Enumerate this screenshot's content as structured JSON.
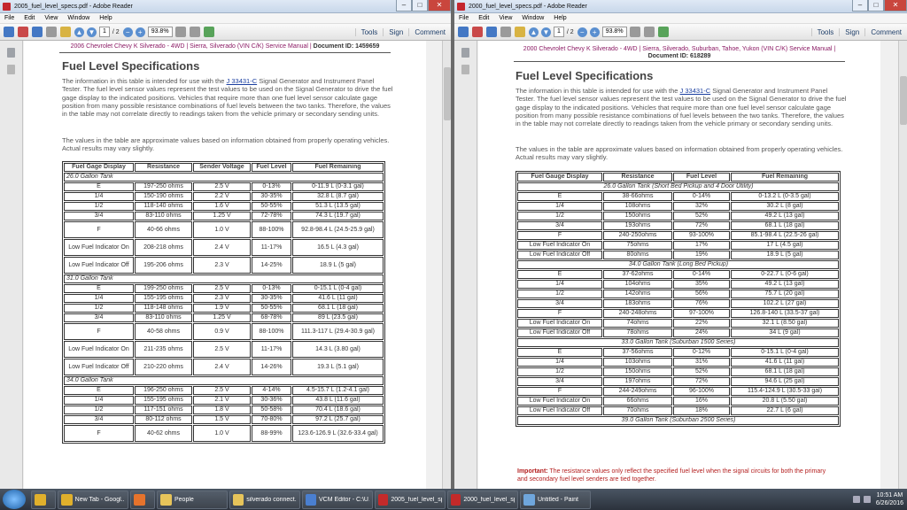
{
  "taskbar": {
    "items": [
      {
        "label": "",
        "icon": "chrome-icon"
      },
      {
        "label": "New Tab - Googl...",
        "icon": "chrome-icon"
      },
      {
        "label": "",
        "icon": "firefox-icon"
      },
      {
        "label": "People",
        "icon": "folder-icon"
      },
      {
        "label": "silverado connect...",
        "icon": "folder-icon"
      },
      {
        "label": "VCM Editor - C:\\U...",
        "icon": "vcm-icon"
      },
      {
        "label": "2005_fuel_level_sp...",
        "icon": "pdf-icon"
      },
      {
        "label": "2000_fuel_level_sp...",
        "icon": "pdf-icon"
      },
      {
        "label": "Untitled - Paint",
        "icon": "paint-icon"
      }
    ],
    "clock": {
      "time": "10:51 AM",
      "date": "6/26/2016"
    }
  },
  "w1": {
    "title": "2005_fuel_level_specs.pdf - Adobe Reader",
    "menu": [
      "File",
      "Edit",
      "View",
      "Window",
      "Help"
    ],
    "page": "1",
    "pages": "/ 2",
    "zoom": "93.8%",
    "tools": "Tools",
    "sign": "Sign",
    "comment": "Comment",
    "hdr_vehicle": "2006 Chevrolet Chevy K Silverado - 4WD",
    "hdr_sep": " | ",
    "hdr_manual": "Sierra, Silverado (VIN C/K) Service Manual",
    "hdr_sep2": " | ",
    "doc_id": "Document ID: 1459659",
    "heading": "Fuel Level Specifications",
    "p1a": "The information in this table is intended for use with the ",
    "p1link": "J 33431-C",
    "p1b": " Signal Generator and Instrument Panel Tester. The fuel level sensor values represent the test values to be used on the Signal Generator to drive the fuel gage display to the indicated positions. Vehicles that require more than one fuel level sensor calculate gage position from many possible resistance combinations of fuel levels between the two tanks. Therefore, the values in the table may not correlate directly to readings taken from the vehicle primary or secondary sending units.",
    "p2": "The values in the table are approximate values based on information obtained from properly operating vehicles. Actual results may vary slightly.",
    "cols": [
      "Fuel Gage Display",
      "Resistance",
      "Sender Voltage",
      "Fuel Level",
      "Fuel Remaining"
    ],
    "rows": [
      {
        "sec": "26.0 Gallon Tank"
      },
      {
        "c": [
          "E",
          "197-250 ohms",
          "2.5 V",
          "0-13%",
          "0-11.9 L (0-3.1 gal)"
        ]
      },
      {
        "c": [
          "1/4",
          "150-190 ohms",
          "2.2 V",
          "30-35%",
          "32.8 L (8.7 gal)"
        ]
      },
      {
        "c": [
          "1/2",
          "118-140 ohms",
          "1.6 V",
          "50-55%",
          "51.3 L (13.5 gal)"
        ]
      },
      {
        "c": [
          "3/4",
          "83-110 ohms",
          "1.25 V",
          "72-78%",
          "74.3 L (19.7 gal)"
        ]
      },
      {
        "c": [
          "F",
          "40-66 ohms",
          "1.0 V",
          "88-100%",
          "92.8-98.4 L (24.5-25.9 gal)"
        ],
        "tall": 1
      },
      {
        "c": [
          "Low Fuel Indicator On",
          "208-218 ohms",
          "2.4 V",
          "11-17%",
          "16.5 L (4.3 gal)"
        ],
        "tall": 1
      },
      {
        "c": [
          "Low Fuel Indicator Off",
          "195-206 ohms",
          "2.3 V",
          "14-25%",
          "18.9 L (5 gal)"
        ],
        "tall": 1
      },
      {
        "sec": "31.0 Gallon Tank"
      },
      {
        "c": [
          "E",
          "199-250 ohms",
          "2.5 V",
          "0-13%",
          "0-15.1 L (0-4 gal)"
        ]
      },
      {
        "c": [
          "1/4",
          "155-195 ohms",
          "2.3 V",
          "30-35%",
          "41.6 L (11 gal)"
        ]
      },
      {
        "c": [
          "1/2",
          "118-148 ohms",
          "1.9 V",
          "50-55%",
          "68.1 L (18 gal)"
        ]
      },
      {
        "c": [
          "3/4",
          "83-110 ohms",
          "1.25 V",
          "68-78%",
          "89 L (23.5 gal)"
        ]
      },
      {
        "c": [
          "F",
          "40-58 ohms",
          "0.9 V",
          "88-100%",
          "111.3-117 L (29.4-30.9 gal)"
        ],
        "tall": 1
      },
      {
        "c": [
          "Low Fuel Indicator On",
          "211-235 ohms",
          "2.5 V",
          "11-17%",
          "14.3 L (3.80 gal)"
        ],
        "tall": 1
      },
      {
        "c": [
          "Low Fuel Indicator Off",
          "210-220 ohms",
          "2.4 V",
          "14-26%",
          "19.3 L (5.1 gal)"
        ],
        "tall": 1
      },
      {
        "sec": "34.0 Gallon Tank"
      },
      {
        "c": [
          "E",
          "196-250 ohms",
          "2.5 V",
          "4-14%",
          "4.5-15.7 L (1.2-4.1 gal)"
        ]
      },
      {
        "c": [
          "1/4",
          "155-195 ohms",
          "2.1 V",
          "30-36%",
          "43.8 L (11.6 gal)"
        ]
      },
      {
        "c": [
          "1/2",
          "117-151 ohms",
          "1.8 V",
          "50-58%",
          "70.4 L (18.6 gal)"
        ]
      },
      {
        "c": [
          "3/4",
          "80-112 ohms",
          "1.5 V",
          "70-80%",
          "97.2 L (25.7 gal)"
        ]
      },
      {
        "c": [
          "F",
          "40-62 ohms",
          "1.0 V",
          "88-99%",
          "123.6-126.9 L (32.6-33.4 gal)"
        ],
        "tall": 1
      }
    ]
  },
  "w2": {
    "title": "2000_fuel_level_specs.pdf - Adobe Reader",
    "menu": [
      "File",
      "Edit",
      "View",
      "Window",
      "Help"
    ],
    "page": "1",
    "pages": "/ 2",
    "zoom": "93.8%",
    "tools": "Tools",
    "sign": "Sign",
    "comment": "Comment",
    "hdr_vehicle": "2000 Chevrolet Chevy K Silverado - 4WD",
    "hdr_sep": " | ",
    "hdr_manual": "Sierra, Silverado, Suburban, Tahoe, Yukon (VIN C/K) Service Manual",
    "hdr_sep2": " | ",
    "doc_id": "Document ID: 618289",
    "heading": "Fuel Level Specifications",
    "p1a": "The information in this table is intended for use with the ",
    "p1link": "J 33431-C",
    "p1b": " Signal Generator and Instrument Panel Tester. The fuel level sensor values represent the test values to be used on the Signal Generator to drive the fuel gage display to the indicated positions. Vehicles that require more than one fuel level sensor calculate gage position from many possible resistance combinations of fuel levels between the two tanks. Therefore, the values in the table may not correlate directly to readings taken from the vehicle primary or secondary sending units.",
    "p2": "The values in the table are approximate values based on information obtained from properly operating vehicles. Actual results may vary slightly.",
    "cols": [
      "Fuel Gauge Display",
      "Resistance",
      "Fuel Level",
      "Fuel Remaining"
    ],
    "rows": [
      {
        "sec": "26.0 Gallon Tank (Short Bed Pickup and 4 Door Utility)"
      },
      {
        "c": [
          "E",
          "38-66ohms",
          "0-14%",
          "0-13.2 L (0-3.5 gal)"
        ]
      },
      {
        "c": [
          "1/4",
          "108ohms",
          "32%",
          "30.2 L (8 gal)"
        ]
      },
      {
        "c": [
          "1/2",
          "150ohms",
          "52%",
          "49.2 L (13 gal)"
        ]
      },
      {
        "c": [
          "3/4",
          "193ohms",
          "72%",
          "68.1 L (18 gal)"
        ]
      },
      {
        "c": [
          "F",
          "240-250ohms",
          "93-100%",
          "85.1-98.4 L (22.5-26 gal)"
        ]
      },
      {
        "c": [
          "Low Fuel Indicator On",
          "75ohms",
          "17%",
          "17 L (4.5 gal)"
        ]
      },
      {
        "c": [
          "Low Fuel Indicator Off",
          "80ohms",
          "19%",
          "18.9 L (5 gal)"
        ]
      },
      {
        "sec": "34.0 Gallon Tank (Long Bed Pickup)"
      },
      {
        "c": [
          "E",
          "37-62ohms",
          "0-14%",
          "0-22.7 L (0-6 gal)"
        ]
      },
      {
        "c": [
          "1/4",
          "104ohms",
          "35%",
          "49.2 L (13 gal)"
        ]
      },
      {
        "c": [
          "1/2",
          "142ohms",
          "56%",
          "75.7 L (20 gal)"
        ]
      },
      {
        "c": [
          "3/4",
          "183ohms",
          "76%",
          "102.2 L (27 gal)"
        ]
      },
      {
        "c": [
          "F",
          "240-248ohms",
          "97-100%",
          "126.8-140 L (33.5-37 gal)"
        ]
      },
      {
        "c": [
          "Low Fuel Indicator On",
          "74ohms",
          "22%",
          "32.1 L (8.50 gal)"
        ]
      },
      {
        "c": [
          "Low Fuel Indicator Off",
          "78ohms",
          "24%",
          "34 L (9 gal)"
        ]
      },
      {
        "sec": "33.0 Gallon Tank (Suburban 1500 Series)"
      },
      {
        "c": [
          "E",
          "37-56ohms",
          "0-12%",
          "0-15.1 L (0-4 gal)"
        ]
      },
      {
        "c": [
          "1/4",
          "103ohms",
          "31%",
          "41.6 L (11 gal)"
        ]
      },
      {
        "c": [
          "1/2",
          "150ohms",
          "52%",
          "68.1 L (18 gal)"
        ]
      },
      {
        "c": [
          "3/4",
          "197ohms",
          "72%",
          "94.6 L (25 gal)"
        ]
      },
      {
        "c": [
          "F",
          "244-249ohms",
          "96-100%",
          "115.4-124.9 L (30.5-33 gal)"
        ]
      },
      {
        "c": [
          "Low Fuel Indicator On",
          "66ohms",
          "16%",
          "20.8 L (5.50 gal)"
        ]
      },
      {
        "c": [
          "Low Fuel Indicator Off",
          "70ohms",
          "18%",
          "22.7 L (6 gal)"
        ]
      },
      {
        "sec": "39.0 Gallon Tank (Suburban 2500 Series)"
      }
    ],
    "important_label": "Important:",
    "important_text": " The resistance values only reflect the specified fuel level when the signal circuits for both the primary and secondary fuel level senders are tied together."
  }
}
